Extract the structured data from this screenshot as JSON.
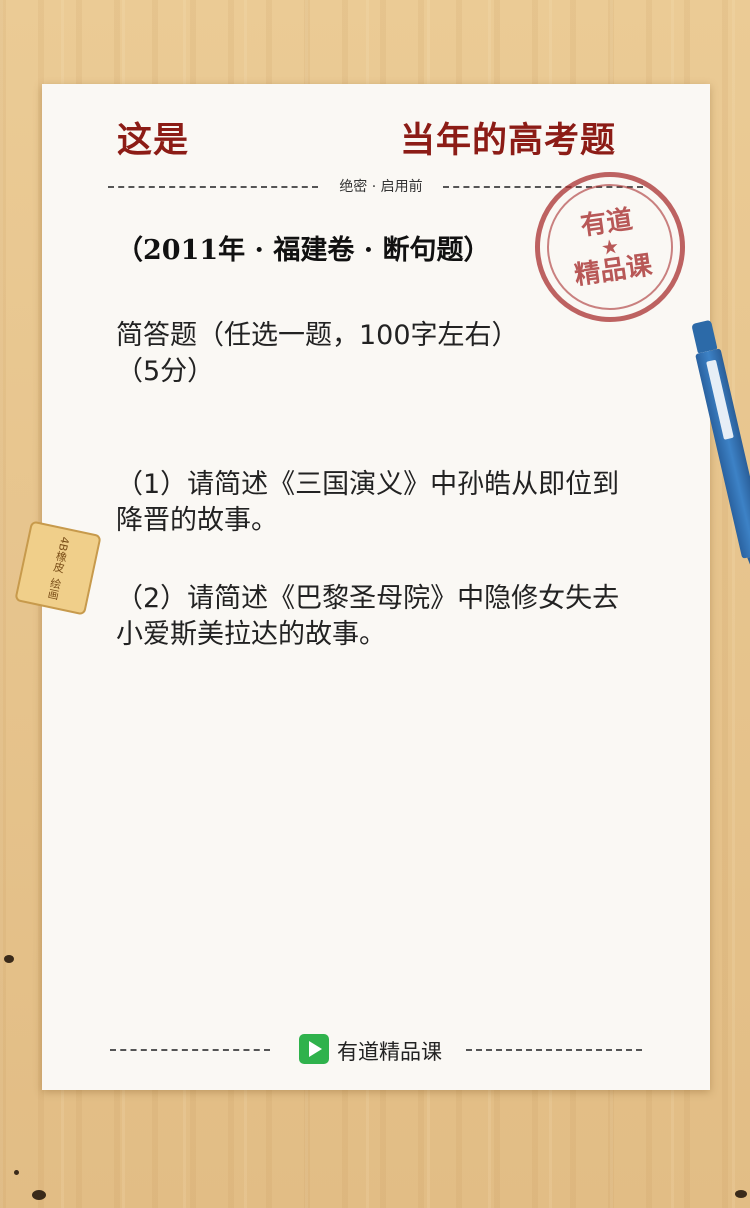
{
  "header": {
    "title_left": "这是",
    "title_right": "当年的高考题",
    "secret_label": "绝密 · 启用前"
  },
  "stamp": {
    "line1": "有道",
    "star": "★",
    "line2": "精品课",
    "color": "#a83030"
  },
  "question": {
    "heading": "（2011年 · 福建卷 · 断句题）",
    "intro_line1": "简答题（任选一题，100字左右）",
    "intro_line2": "（5分）",
    "q1": "（1）请简述《三国演义》中孙皓从即位到降晋的故事。",
    "q2": "（2）请简述《巴黎圣母院》中隐修女失去小爱斯美拉达的故事。"
  },
  "eraser": {
    "text_a": "4B橡皮",
    "text_b": "绘画"
  },
  "footer": {
    "brand": "有道精品课",
    "logo_icon": "play-logo-icon",
    "brand_color": "#2fb24c"
  },
  "colors": {
    "title": "#8c1c16",
    "paper": "#faf8f4",
    "background": "#e6c58f"
  }
}
